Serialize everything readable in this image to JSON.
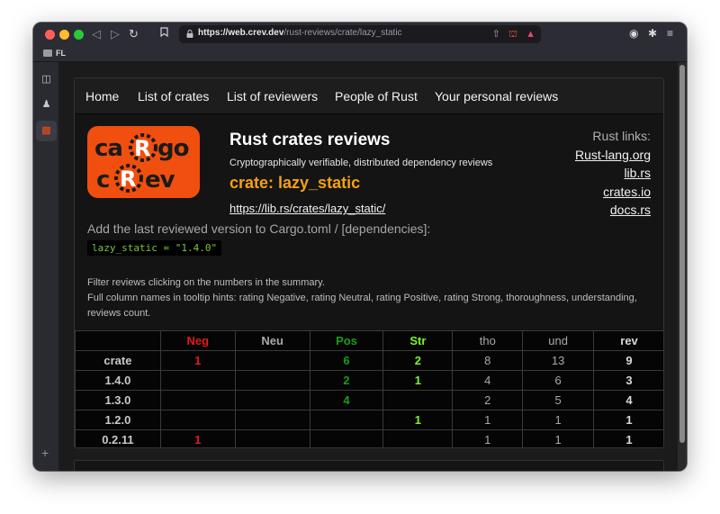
{
  "browser": {
    "url_host": "https://web.crev.dev",
    "url_path": "/rust-reviews/crate/lazy_static",
    "bookmark_folder": "FL"
  },
  "nav": {
    "items": [
      "Home",
      "List of crates",
      "List of reviewers",
      "People of Rust",
      "Your personal reviews"
    ]
  },
  "logo": {
    "line1": "caRgo",
    "line2": "cRev"
  },
  "header": {
    "title": "Rust crates reviews",
    "subtitle": "Cryptographically verifiable, distributed dependency reviews",
    "crate": "crate: lazy_static",
    "librs_url": "https://lib.rs/crates/lazy_static/"
  },
  "rust_links": {
    "heading": "Rust links:",
    "links": [
      "Rust-lang.org",
      "lib.rs",
      "crates.io",
      "docs.rs"
    ]
  },
  "cargo": {
    "hint": "Add the last reviewed version to Cargo.toml / [dependencies]:",
    "code": "lazy_static = \"1.4.0\""
  },
  "filter_note": {
    "line1": "Filter reviews clicking on the numbers in the summary.",
    "line2": "Full column names in tooltip hints: rating Negative, rating Neutral, rating Positive, rating Strong, thoroughness, understanding, reviews count."
  },
  "summary": {
    "headers": [
      "",
      "Neg",
      "Neu",
      "Pos",
      "Str",
      "tho",
      "und",
      "rev"
    ],
    "rows": [
      {
        "label": "crate",
        "neg": "1",
        "neu": "",
        "pos": "6",
        "str": "2",
        "tho": "8",
        "und": "13",
        "rev": "9"
      },
      {
        "label": "1.4.0",
        "neg": "",
        "neu": "",
        "pos": "2",
        "str": "1",
        "tho": "4",
        "und": "6",
        "rev": "3"
      },
      {
        "label": "1.3.0",
        "neg": "",
        "neu": "",
        "pos": "4",
        "str": "",
        "tho": "2",
        "und": "5",
        "rev": "4"
      },
      {
        "label": "1.2.0",
        "neg": "",
        "neu": "",
        "pos": "",
        "str": "1",
        "tho": "1",
        "und": "1",
        "rev": "1"
      },
      {
        "label": "0.2.11",
        "neg": "1",
        "neu": "",
        "pos": "",
        "str": "",
        "tho": "1",
        "und": "1",
        "rev": "1"
      }
    ]
  },
  "colors": {
    "accent_orange": "#f5a012",
    "logo_bg": "#f04f0f",
    "neg": "#e01b1b",
    "pos": "#1a9c1a",
    "str": "#7cf32a"
  }
}
